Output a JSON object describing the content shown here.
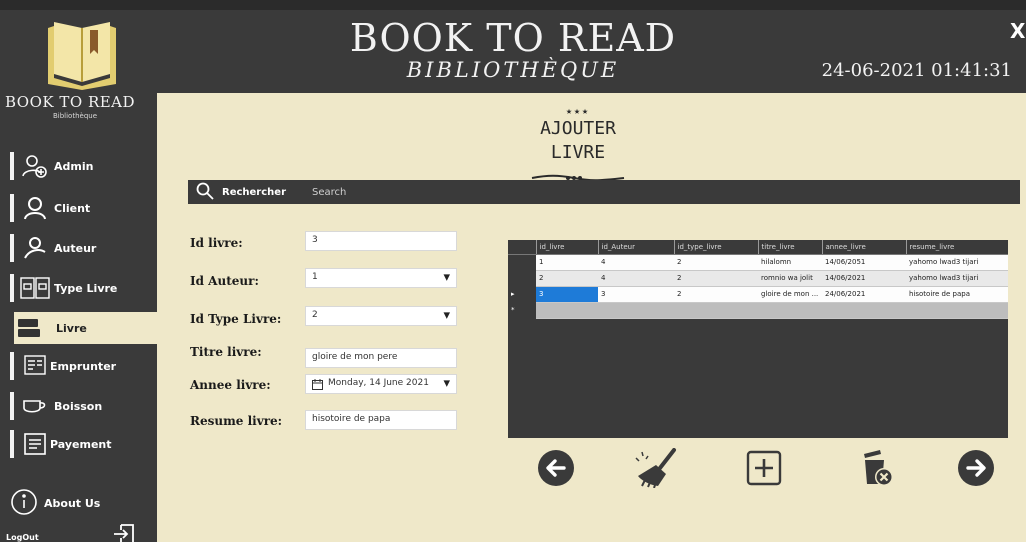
{
  "header": {
    "title": "BOOK TO READ",
    "subtitle": "BIBLIOTHÈQUE",
    "datetime": "24-06-2021 01:41:31",
    "close_label": "X"
  },
  "sidebar": {
    "brand_title": "BOOK TO READ",
    "brand_subtitle": "Bibliothèque",
    "items": [
      {
        "label": "Admin",
        "icon": "admin-add-user-icon"
      },
      {
        "label": "Client",
        "icon": "user-icon"
      },
      {
        "label": "Auteur",
        "icon": "author-icon"
      },
      {
        "label": "Type Livre",
        "icon": "book-types-icon"
      },
      {
        "label": "Livre",
        "icon": "book-stack-icon",
        "active": true
      },
      {
        "label": "Emprunter",
        "icon": "borrow-icon"
      },
      {
        "label": "Boisson",
        "icon": "cup-icon"
      },
      {
        "label": "Payement",
        "icon": "receipt-icon"
      }
    ],
    "about_label": "About Us",
    "logout_label": "LogOut"
  },
  "section_title_line1": "AJOUTER",
  "section_title_line2": "LIVRE",
  "search": {
    "button_label": "Rechercher",
    "placeholder": "Search"
  },
  "form": {
    "id_livre": {
      "label": "Id livre:",
      "value": "3"
    },
    "id_auteur": {
      "label": "Id Auteur:",
      "value": "1"
    },
    "id_type_livre": {
      "label": "Id Type Livre:",
      "value": "2"
    },
    "titre_livre": {
      "label": "Titre livre:",
      "value": "gloire de mon pere"
    },
    "annee_livre": {
      "label": "Annee livre:",
      "value": "Monday, 14 June 2021"
    },
    "resume_livre": {
      "label": "Resume livre:",
      "value": "hisotoire de papa"
    }
  },
  "table": {
    "columns": [
      "id_livre",
      "id_Auteur",
      "id_type_livre",
      "titre_livre",
      "annee_livre",
      "resume_livre"
    ],
    "rows": [
      [
        "1",
        "4",
        "2",
        "hilalomn",
        "14/06/2051",
        "yahomo lwad3 tijari"
      ],
      [
        "2",
        "4",
        "2",
        "romnio wa jolit",
        "14/06/2021",
        "yahomo lwad3 tijari"
      ],
      [
        "3",
        "3",
        "2",
        "gloire de mon ...",
        "24/06/2021",
        "hisotoire de papa"
      ]
    ]
  },
  "colors": {
    "dark": "#3a3a3a",
    "cream": "#efe8c9",
    "selection": "#1e7bd8"
  }
}
